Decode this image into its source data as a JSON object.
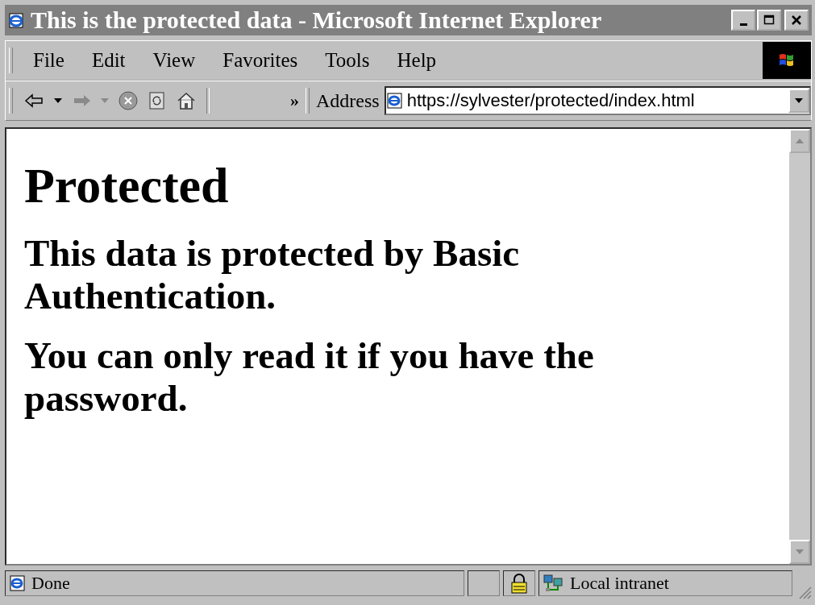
{
  "window": {
    "title": "This is the protected data - Microsoft Internet Explorer"
  },
  "menu": [
    "File",
    "Edit",
    "View",
    "Favorites",
    "Tools",
    "Help"
  ],
  "address": {
    "label": "Address",
    "value": "https://sylvester/protected/index.html"
  },
  "chevron": "»",
  "page": {
    "heading": "Protected",
    "paragraphs": [
      "This data is protected by Basic Authentication.",
      "You can only read it if you have the password."
    ]
  },
  "status_bar": {
    "text": "Done",
    "zone": "Local intranet",
    "secure": true
  }
}
